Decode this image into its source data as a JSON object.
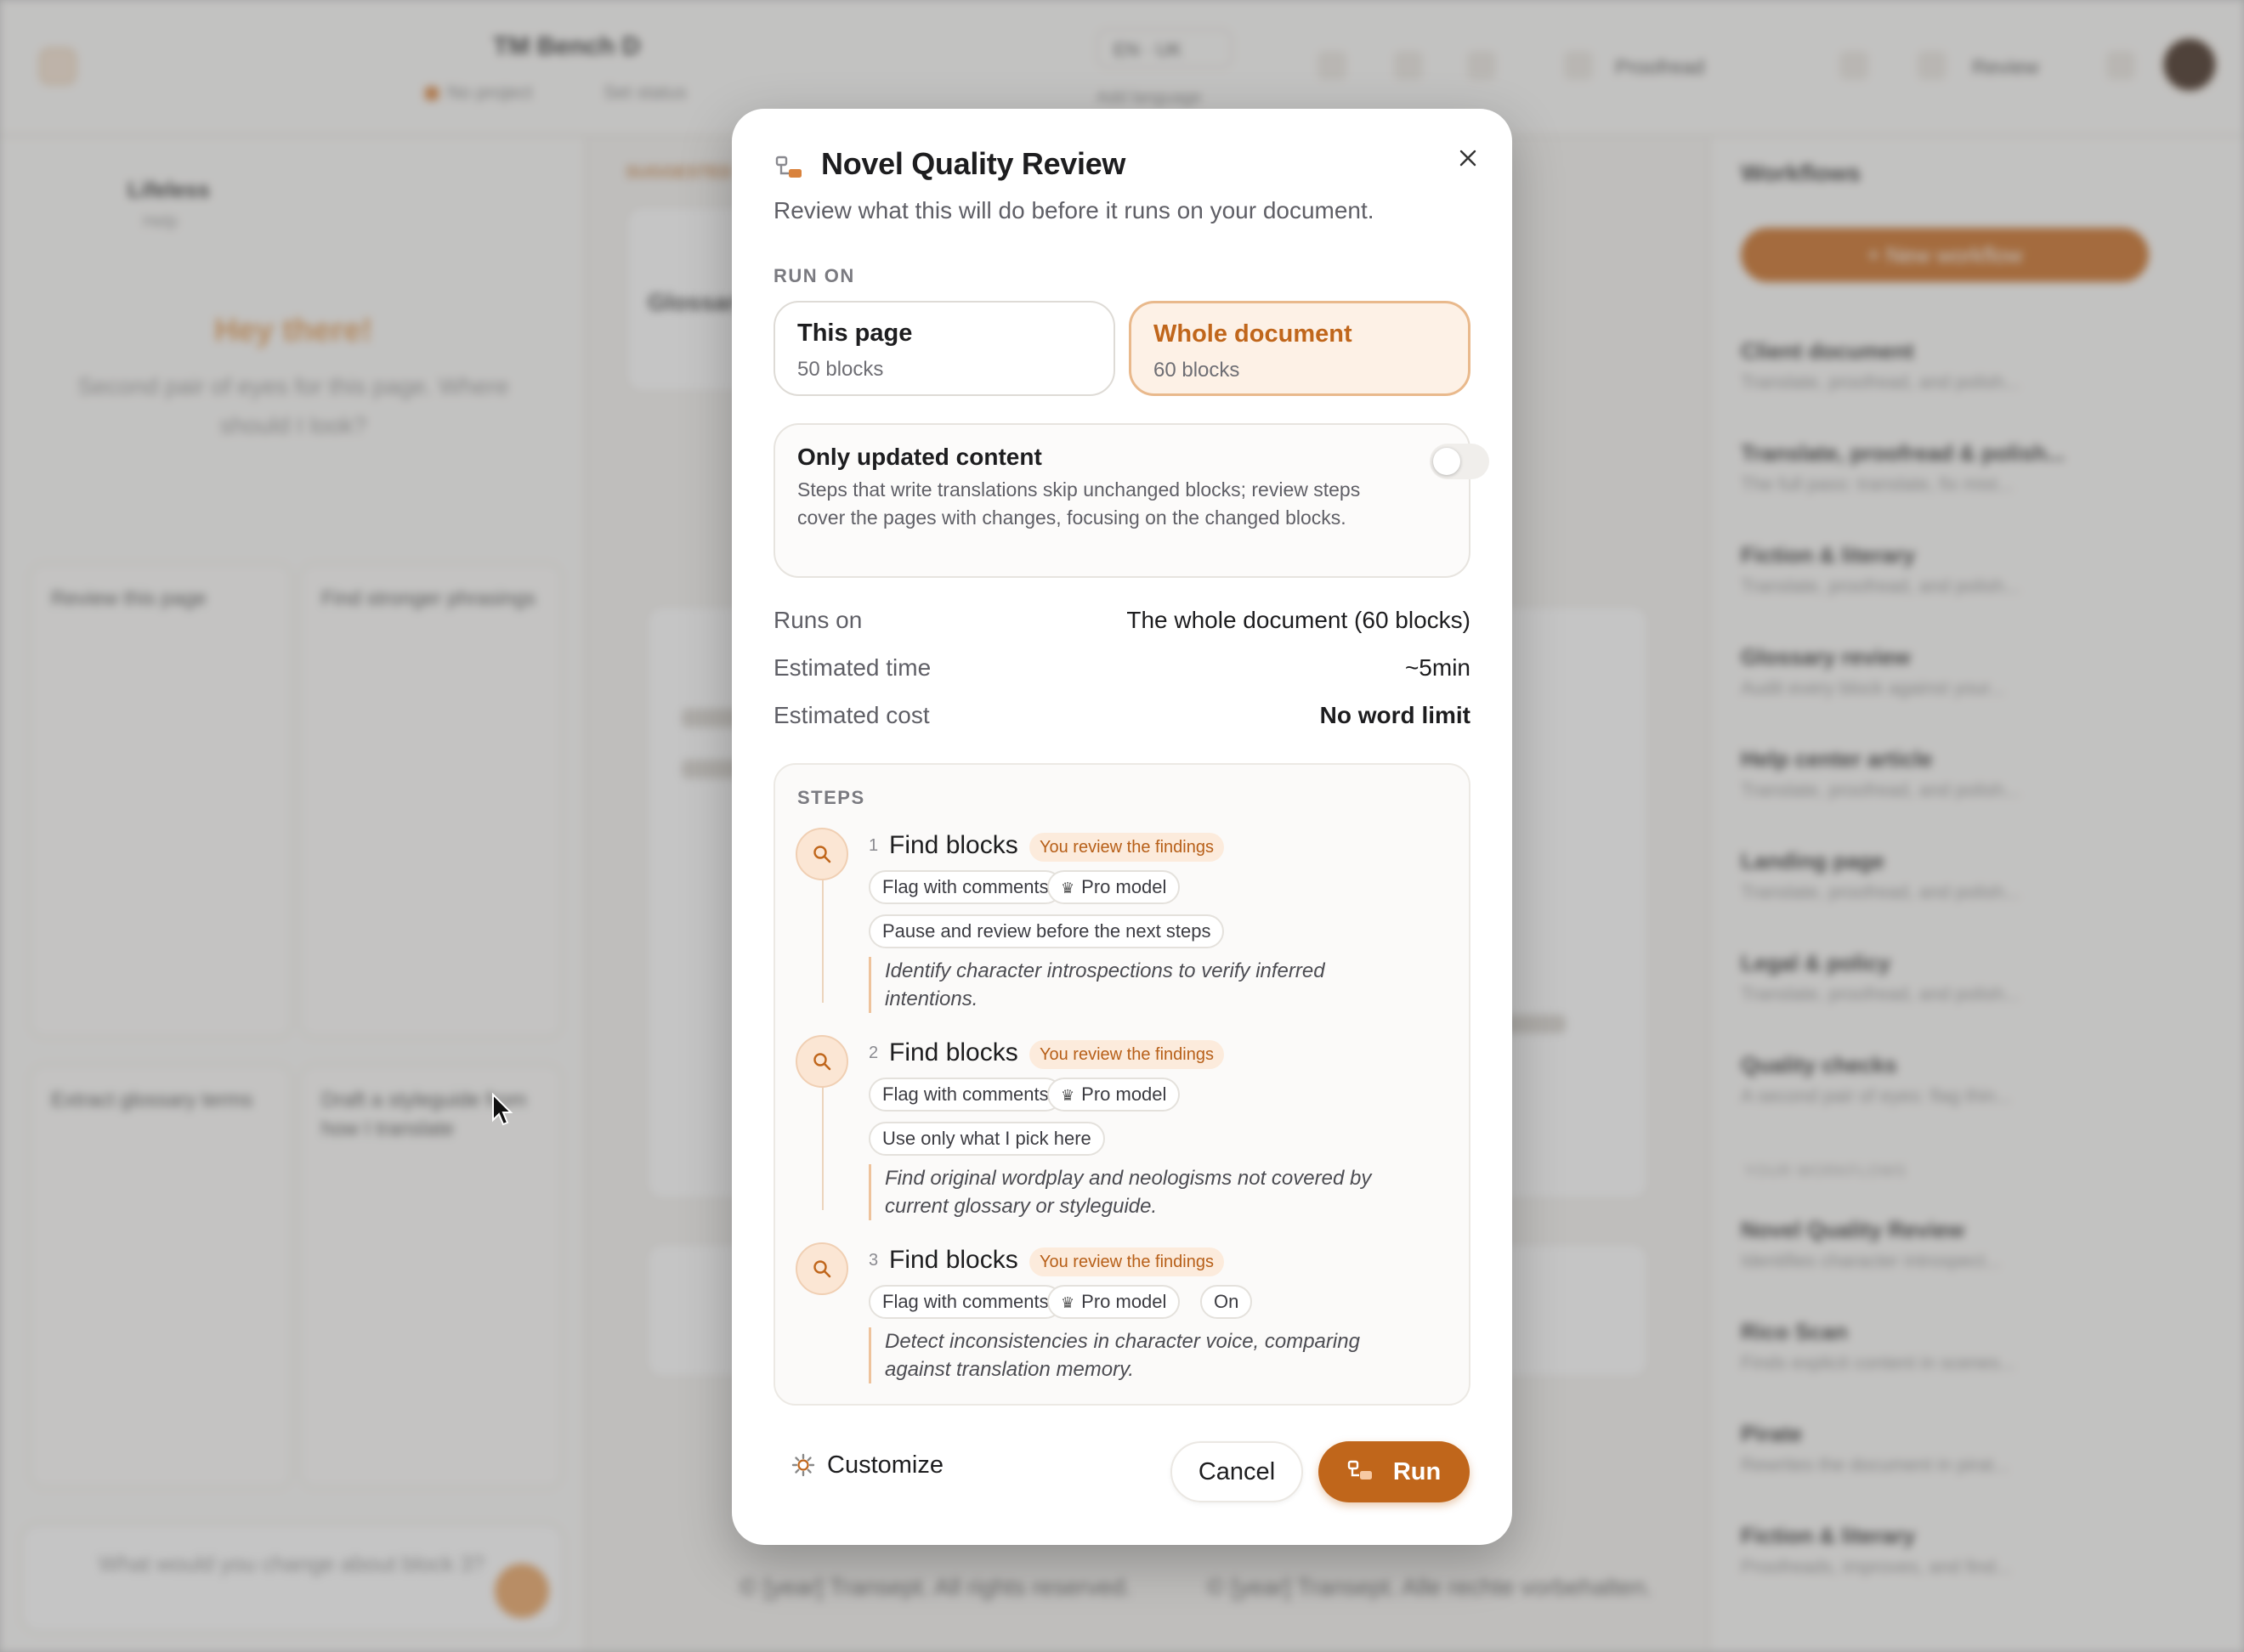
{
  "background": {
    "document_title": "TM Bench D",
    "project": "No project",
    "status": "Set status",
    "language": "EN · UK",
    "add_language": "Add language",
    "mode": "Proofread",
    "review": "Review",
    "left_panel": {
      "title": "Lifeless",
      "subtitle": "Help",
      "greeting": "Hey there!",
      "prompt": "Second pair of eyes for this page. Where should I look?",
      "cards": [
        "Review this page",
        "Find stronger phrasings",
        "Extract glossary terms",
        "Draft a styleguide from how I translate"
      ],
      "input_placeholder": "What would you change about block 3?"
    },
    "center": {
      "suggested": "SUGGESTED",
      "card_title": "Glossary",
      "footer_left": "© [year] Transept. All rights reserved.",
      "footer_right": "© [year] Transept. Alle rechte vorbehalten."
    },
    "workflows": {
      "title": "Workflows",
      "new_button": "+ New workflow",
      "items": [
        {
          "title": "Client document",
          "desc": "Translate, proofread, and polish..."
        },
        {
          "title": "Translate, proofread & polish...",
          "desc": "The full pass: translate, fix mist..."
        },
        {
          "title": "Fiction & literary",
          "desc": "Translate, proofread, and polish..."
        },
        {
          "title": "Glossary review",
          "desc": "Audit every block against your..."
        },
        {
          "title": "Help center article",
          "desc": "Translate, proofread, and polish..."
        },
        {
          "title": "Landing page",
          "desc": "Translate, proofread, and polish..."
        },
        {
          "title": "Legal & policy",
          "desc": "Translate, proofread, and polish..."
        },
        {
          "title": "Quality checks",
          "desc": "A second pair of eyes: flag thin..."
        }
      ],
      "section": "YOUR WORKFLOWS",
      "user_items": [
        {
          "title": "Novel Quality Review",
          "desc": "Identifies character introspect..."
        },
        {
          "title": "Rico Scan",
          "desc": "Finds explicit content in scenes..."
        },
        {
          "title": "Pirate",
          "desc": "Rewrites the document in pirat..."
        },
        {
          "title": "Fiction & literary",
          "desc": "Proofreads, improves, and find..."
        }
      ]
    }
  },
  "modal": {
    "title": "Novel Quality Review",
    "subtitle": "Review what this will do before it runs on your document.",
    "run_on_label": "RUN ON",
    "options": [
      {
        "title": "This page",
        "sub": "50 blocks",
        "selected": false
      },
      {
        "title": "Whole document",
        "sub": "60 blocks",
        "selected": true
      }
    ],
    "only_updated": {
      "title": "Only updated content",
      "description": "Steps that write translations skip unchanged blocks; review steps cover the pages with changes, focusing on the changed blocks.",
      "enabled": false
    },
    "summary": [
      {
        "key": "Runs on",
        "value": "The whole document (60 blocks)"
      },
      {
        "key": "Estimated time",
        "value": "~5min"
      },
      {
        "key": "Estimated cost",
        "value": "No word limit"
      }
    ],
    "steps_label": "STEPS",
    "steps": [
      {
        "number": "1",
        "name": "Find blocks",
        "badge": "You review the findings",
        "chips": [
          "Flag with comments",
          "Pro model"
        ],
        "extra_chip": "Pause and review before the next steps",
        "instruction": "Identify character introspections to verify inferred intentions."
      },
      {
        "number": "2",
        "name": "Find blocks",
        "badge": "You review the findings",
        "chips": [
          "Flag with comments",
          "Pro model"
        ],
        "extra_chip": "Use only what I pick here",
        "instruction": "Find original wordplay and neologisms not covered by current glossary or styleguide."
      },
      {
        "number": "3",
        "name": "Find blocks",
        "badge": "You review the findings",
        "chips": [
          "Flag with comments",
          "Pro model",
          "On"
        ],
        "instruction": "Detect inconsistencies in character voice, comparing against translation memory."
      }
    ],
    "buttons": {
      "customize": "Customize",
      "cancel": "Cancel",
      "run": "Run"
    },
    "accent_color": "#c0661b"
  }
}
